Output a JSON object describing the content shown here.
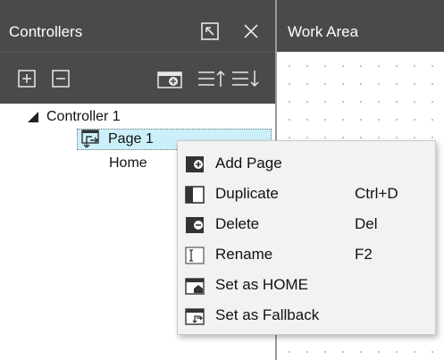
{
  "controllers_panel": {
    "title": "Controllers",
    "header_icons": [
      "undock-icon",
      "close-icon"
    ],
    "toolbar_icons": [
      "expand-all-icon",
      "collapse-all-icon",
      "add-page-icon",
      "sort-up-icon",
      "sort-down-icon"
    ],
    "tree": {
      "root_label": "Controller 1",
      "selected_page_label": "Page 1",
      "home_label": "Home"
    }
  },
  "work_area": {
    "title": "Work Area"
  },
  "context_menu": {
    "items": [
      {
        "label": "Add Page",
        "shortcut": "",
        "icon": "add-page-icon"
      },
      {
        "label": "Duplicate",
        "shortcut": "Ctrl+D",
        "icon": "duplicate-icon"
      },
      {
        "label": "Delete",
        "shortcut": "Del",
        "icon": "delete-icon"
      },
      {
        "label": "Rename",
        "shortcut": "F2",
        "icon": "rename-icon"
      },
      {
        "label": "Set as HOME",
        "shortcut": "",
        "icon": "set-home-icon"
      },
      {
        "label": "Set as Fallback",
        "shortcut": "",
        "icon": "set-fallback-icon"
      }
    ]
  },
  "colors": {
    "panel_header": "#4a4a4a",
    "selection": "#ccf0fa",
    "menu_bg": "#f2f2f2"
  }
}
